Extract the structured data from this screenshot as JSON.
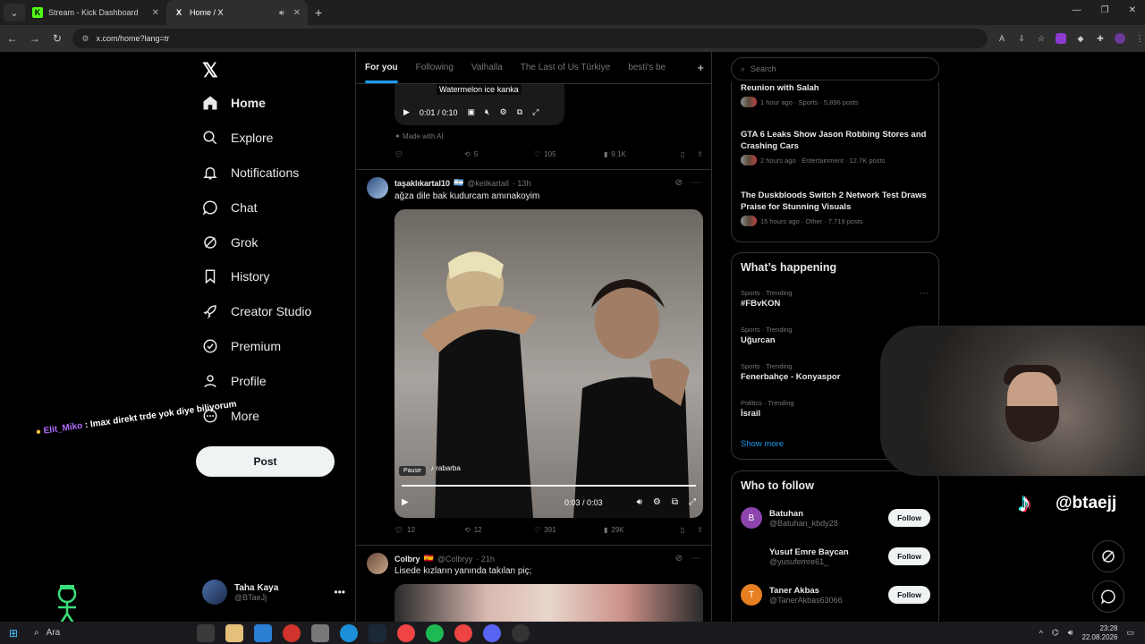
{
  "browser": {
    "tabs": [
      {
        "title": "Stream - Kick Dashboard",
        "favicon": "K",
        "active": false
      },
      {
        "title": "Home / X",
        "favicon": "X",
        "active": true
      }
    ],
    "url": "x.com/home?lang=tr"
  },
  "nav": {
    "items": [
      {
        "label": "Home",
        "icon": "home-icon"
      },
      {
        "label": "Explore",
        "icon": "search-icon"
      },
      {
        "label": "Notifications",
        "icon": "bell-icon"
      },
      {
        "label": "Chat",
        "icon": "chat-icon"
      },
      {
        "label": "Grok",
        "icon": "grok-icon"
      },
      {
        "label": "History",
        "icon": "bookmark-icon"
      },
      {
        "label": "Creator Studio",
        "icon": "rocket-icon"
      },
      {
        "label": "Premium",
        "icon": "verified-icon"
      },
      {
        "label": "Profile",
        "icon": "person-icon"
      },
      {
        "label": "More",
        "icon": "more-circle-icon"
      }
    ],
    "post_label": "Post"
  },
  "account": {
    "name": "Taha Kaya",
    "handle": "@BTaeJj"
  },
  "overlay_chat": {
    "user": "Elit_Miko",
    "message": ": Imax direkt trde yok diye biliyorum"
  },
  "feed": {
    "tabs": [
      "For you",
      "Following",
      "Valhalla",
      "The Last of Us Türkiye",
      "besti's be"
    ],
    "prev_tweet": {
      "caption": "Watermelon ice kanka",
      "time": "0:01 / 0:10",
      "ai_label": "Made with AI",
      "replies": "",
      "reposts": "5",
      "likes": "105",
      "views": "9.1K"
    },
    "tweet1": {
      "name": "taşaklıkartal10",
      "flag": "🇦🇷",
      "handle": "@keilkartall",
      "age": "· 13h",
      "text": "ağza dile bak kudurcam amınakoyim",
      "pause_tip": "Pause",
      "music": "rabarba",
      "time": "0:03 / 0:03",
      "replies": "12",
      "reposts": "12",
      "likes": "391",
      "views": "29K"
    },
    "tweet2": {
      "name": "Colbry",
      "flag": "🇪🇸",
      "handle": "@Colbryy",
      "age": "· 21h",
      "text": "Lisede kızların yanında takılan piç;"
    }
  },
  "right": {
    "search_placeholder": "Search",
    "news": [
      {
        "title": "Reunion with Salah",
        "meta": "1 hour ago · Sports · 5,896 posts"
      },
      {
        "title": "GTA 6 Leaks Show Jason Robbing Stores and Crashing Cars",
        "meta": "2 hours ago · Entertainment · 12.7K posts"
      },
      {
        "title": "The Duskbloods Switch 2 Network Test Draws Praise for Stunning Visuals",
        "meta": "15 hours ago · Other · 7,719 posts"
      }
    ],
    "happening_title": "What’s happening",
    "trends": [
      {
        "context": "Sports · Trending",
        "name": "#FBvKON"
      },
      {
        "context": "Sports · Trending",
        "name": "Uğurcan"
      },
      {
        "context": "Sports · Trending",
        "name": "Fenerbahçe - Konyaspor"
      },
      {
        "context": "Politics · Trending",
        "name": "İsrail"
      }
    ],
    "show_more": "Show more",
    "who_title": "Who to follow",
    "follow": [
      {
        "name": "Batuhan",
        "handle": "@Batuhan_kbdy28",
        "initial": "B",
        "color": "#8e44ad",
        "btn": "Follow"
      },
      {
        "name": "Yusuf Emre Baycan",
        "handle": "@yusufemre61_",
        "initial": "",
        "color": "#000000",
        "btn": "Follow"
      },
      {
        "name": "Taner Akbas",
        "handle": "@TanerAkbas63066",
        "initial": "T",
        "color": "#e67e22",
        "btn": "Follow"
      }
    ]
  },
  "stream": {
    "tiktok_handle": "@btaejj"
  },
  "taskbar": {
    "search": "Ara",
    "time": "23:28",
    "date": "22.08.2026"
  }
}
